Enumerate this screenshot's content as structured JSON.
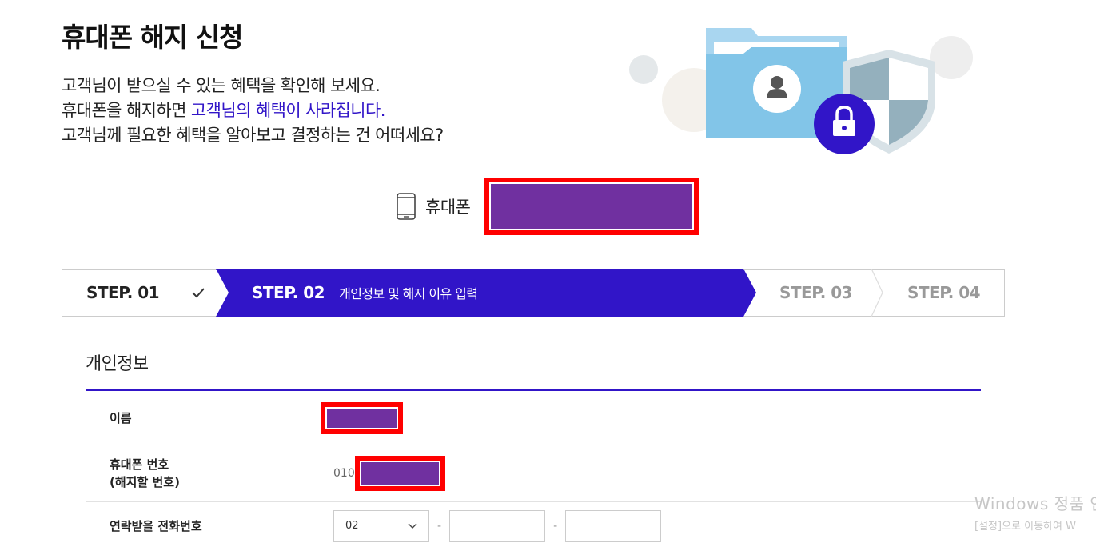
{
  "header": {
    "title": "휴대폰 해지 신청",
    "intro_line1": "고객님이 받으실 수 있는 혜택을 확인해 보세요.",
    "intro_line2_prefix": "휴대폰을 해지하면 ",
    "intro_line2_highlight": "고객님의 혜택이 사라집니다.",
    "intro_line3": "고객님께 필요한 혜택을 알아보고 결정하는 건 어떠세요?"
  },
  "phone_info": {
    "label": "휴대폰",
    "icon": "mobile-phone-icon"
  },
  "steps": [
    {
      "label": "STEP. 01",
      "state": "done",
      "icon": "check-icon"
    },
    {
      "label": "STEP. 02",
      "state": "active",
      "desc": "개인정보 및 해지 이유 입력"
    },
    {
      "label": "STEP. 03",
      "state": "pending"
    },
    {
      "label": "STEP. 04",
      "state": "pending"
    }
  ],
  "personal_info": {
    "title": "개인정보",
    "rows": [
      {
        "label": "이름"
      },
      {
        "label_line1": "휴대폰 번호",
        "label_line2": "(해지할 번호)",
        "prefix": "010"
      },
      {
        "label": "연락받을 전화번호",
        "area_code": "02",
        "separator": "-"
      }
    ]
  },
  "watermark": {
    "line1": "Windows 정품 인",
    "line2": "[설정]으로 이동하여 W"
  },
  "colors": {
    "accent": "#3115c8",
    "redact_border": "#ff0000",
    "redact_fill": "#7030a0",
    "folder_blue": "#82c5e8",
    "shield_gray": "#94b0bd"
  }
}
